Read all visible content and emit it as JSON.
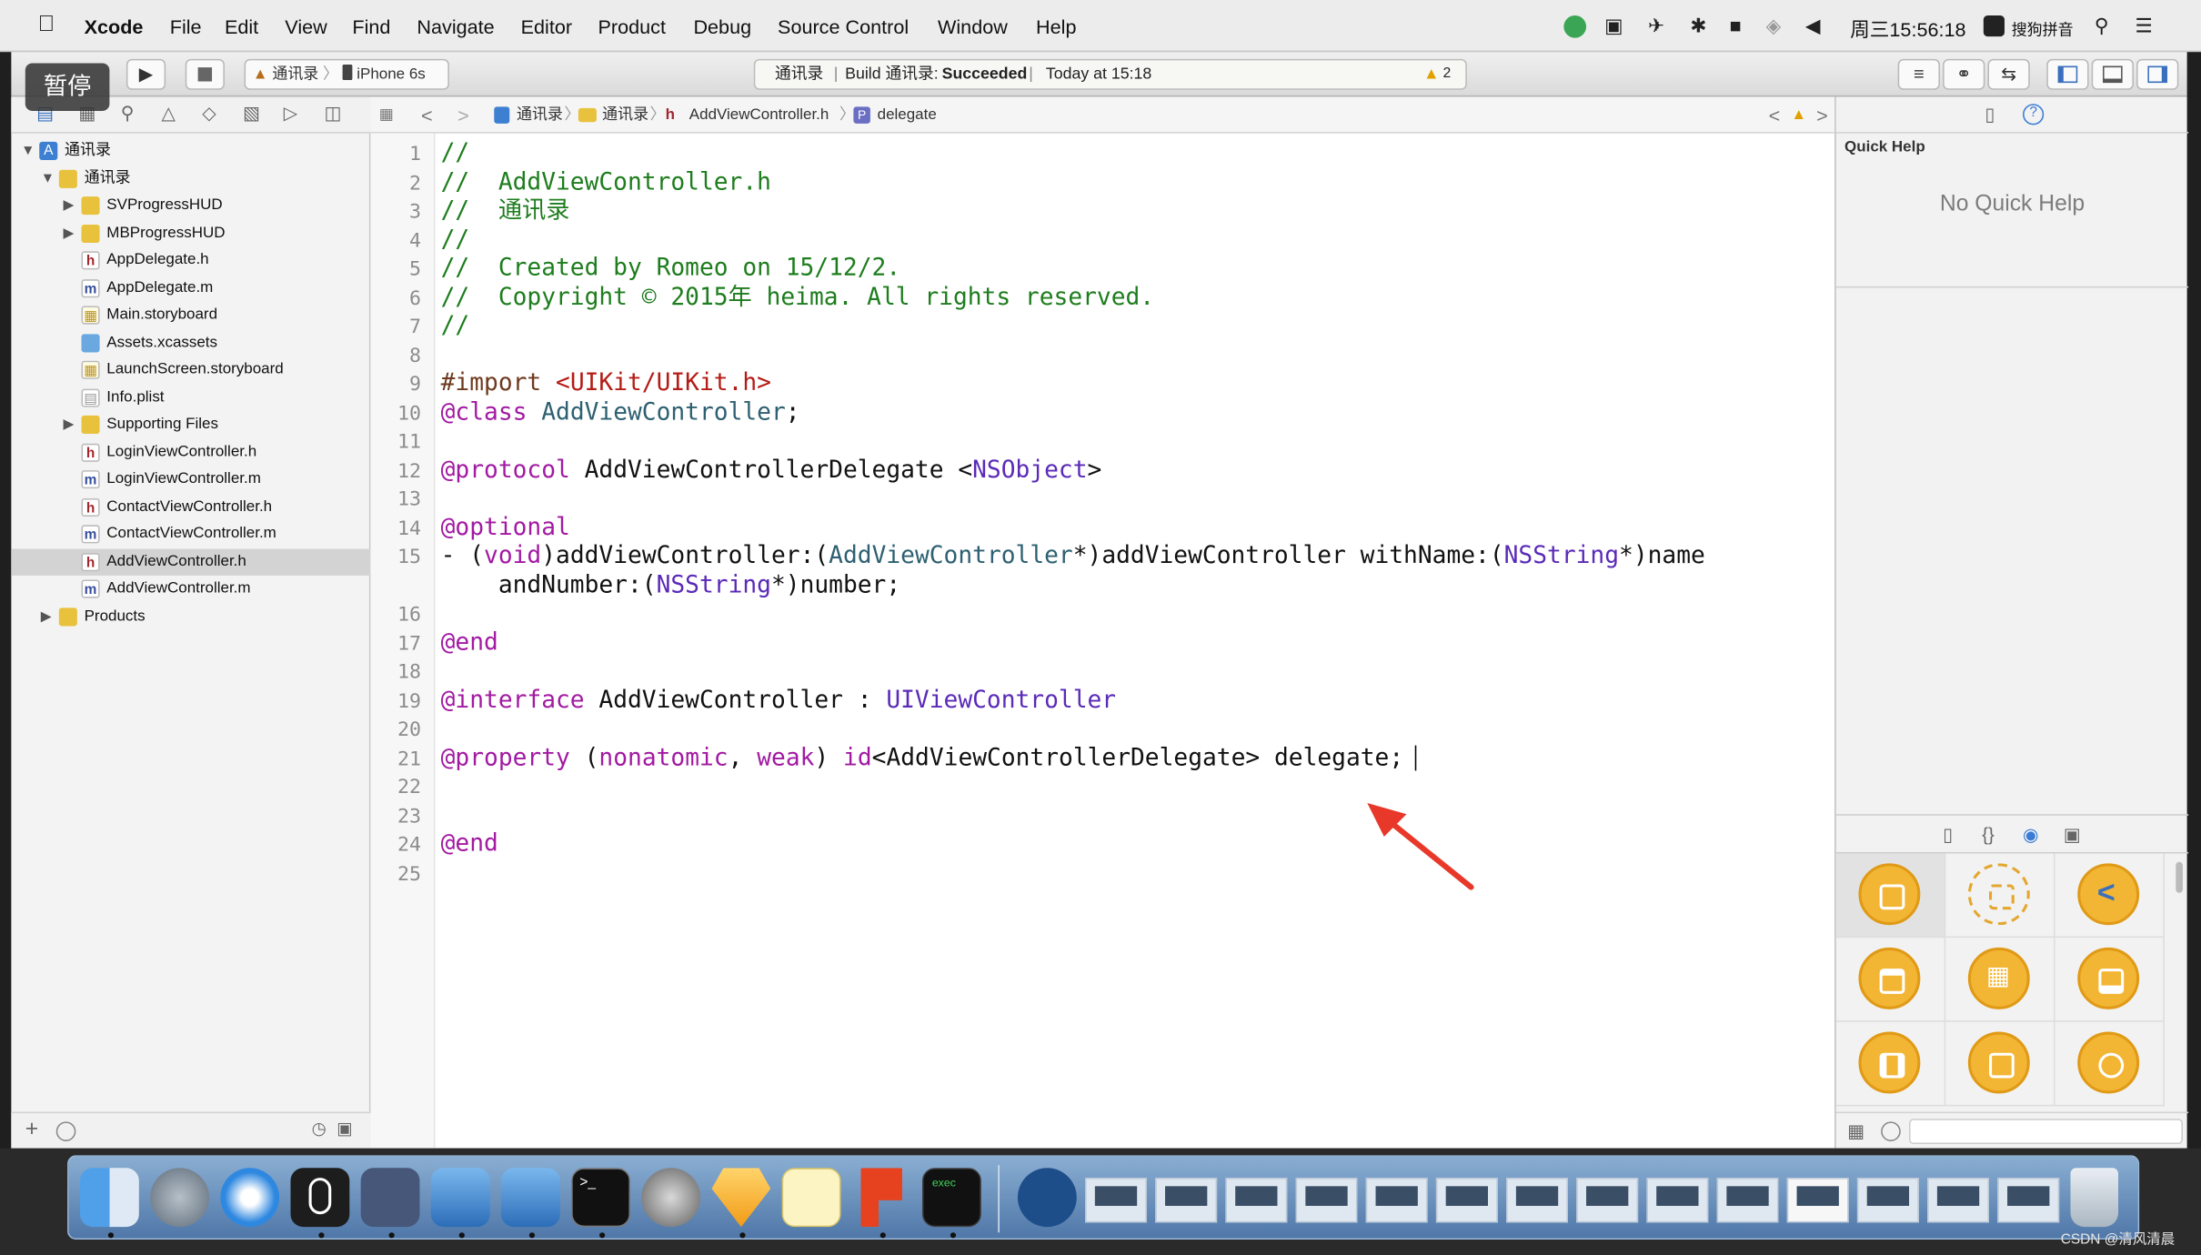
{
  "menubar": {
    "apple_icon": "apple-icon",
    "items": [
      "Xcode",
      "File",
      "Edit",
      "View",
      "Find",
      "Navigate",
      "Editor",
      "Product",
      "Debug",
      "Source Control",
      "Window",
      "Help"
    ],
    "clock": "周三15:56:18",
    "input_method": "搜狗拼音"
  },
  "toolbar": {
    "scheme": "通讯录",
    "device": "iPhone 6s",
    "activity_project": "通讯录",
    "activity_prefix": "Build 通讯录:",
    "activity_status": "Succeeded",
    "activity_time": "Today at 15:18",
    "warning_count": "2"
  },
  "overlay": {
    "paused_label": "暂停"
  },
  "navigator": {
    "items": [
      {
        "label": "通讯录",
        "icon": "project-icon",
        "depth": 0,
        "disclosure": "open"
      },
      {
        "label": "通讯录",
        "icon": "folder-icon",
        "depth": 1,
        "disclosure": "open"
      },
      {
        "label": "SVProgressHUD",
        "icon": "folder-icon",
        "depth": 2,
        "disclosure": "closed"
      },
      {
        "label": "MBProgressHUD",
        "icon": "folder-icon",
        "depth": 2,
        "disclosure": "closed"
      },
      {
        "label": "AppDelegate.h",
        "icon": "header-file-icon",
        "depth": 2
      },
      {
        "label": "AppDelegate.m",
        "icon": "implementation-file-icon",
        "depth": 2
      },
      {
        "label": "Main.storyboard",
        "icon": "storyboard-file-icon",
        "depth": 2
      },
      {
        "label": "Assets.xcassets",
        "icon": "asset-catalog-icon",
        "depth": 2
      },
      {
        "label": "LaunchScreen.storyboard",
        "icon": "storyboard-file-icon",
        "depth": 2
      },
      {
        "label": "Info.plist",
        "icon": "plist-file-icon",
        "depth": 2
      },
      {
        "label": "Supporting Files",
        "icon": "folder-icon",
        "depth": 2,
        "disclosure": "closed"
      },
      {
        "label": "LoginViewController.h",
        "icon": "header-file-icon",
        "depth": 2
      },
      {
        "label": "LoginViewController.m",
        "icon": "implementation-file-icon",
        "depth": 2
      },
      {
        "label": "ContactViewController.h",
        "icon": "header-file-icon",
        "depth": 2
      },
      {
        "label": "ContactViewController.m",
        "icon": "implementation-file-icon",
        "depth": 2
      },
      {
        "label": "AddViewController.h",
        "icon": "header-file-icon",
        "depth": 2,
        "selected": true
      },
      {
        "label": "AddViewController.m",
        "icon": "implementation-file-icon",
        "depth": 2
      },
      {
        "label": "Products",
        "icon": "folder-icon",
        "depth": 1,
        "disclosure": "closed"
      }
    ]
  },
  "jumpbar": {
    "crumbs": [
      "通讯录",
      "通讯录",
      "AddViewController.h",
      "delegate"
    ]
  },
  "editor": {
    "lines": [
      {
        "n": "1",
        "t": [
          [
            "c-com",
            "//"
          ]
        ]
      },
      {
        "n": "2",
        "t": [
          [
            "c-com",
            "//  AddViewController.h"
          ]
        ]
      },
      {
        "n": "3",
        "t": [
          [
            "c-com",
            "//  通讯录"
          ]
        ]
      },
      {
        "n": "4",
        "t": [
          [
            "c-com",
            "//"
          ]
        ]
      },
      {
        "n": "5",
        "t": [
          [
            "c-com",
            "//  Created by Romeo on 15/12/2."
          ]
        ]
      },
      {
        "n": "6",
        "t": [
          [
            "c-com",
            "//  Copyright © 2015年 heima. All rights reserved."
          ]
        ]
      },
      {
        "n": "7",
        "t": [
          [
            "c-com",
            "//"
          ]
        ]
      },
      {
        "n": "8",
        "t": []
      },
      {
        "n": "9",
        "t": [
          [
            "c-pre",
            "#import "
          ],
          [
            "c-str",
            "<UIKit/UIKit.h>"
          ]
        ]
      },
      {
        "n": "10",
        "t": [
          [
            "c-kw",
            "@class "
          ],
          [
            "c-cls",
            "AddViewController"
          ],
          [
            "",
            "; "
          ]
        ]
      },
      {
        "n": "11",
        "t": []
      },
      {
        "n": "12",
        "t": [
          [
            "c-kw",
            "@protocol "
          ],
          [
            "",
            "AddViewControllerDelegate <"
          ],
          [
            "c-typ",
            "NSObject"
          ],
          [
            "",
            ">"
          ]
        ]
      },
      {
        "n": "13",
        "t": []
      },
      {
        "n": "14",
        "t": [
          [
            "c-kw",
            "@optional"
          ]
        ]
      },
      {
        "n": "15",
        "t": [
          [
            "",
            "- ("
          ],
          [
            "c-kw",
            "void"
          ],
          [
            "",
            ")addViewController:("
          ],
          [
            "c-cls",
            "AddViewController"
          ],
          [
            "",
            "*)addViewController withName:("
          ],
          [
            "c-typ",
            "NSString"
          ],
          [
            "",
            "*)name"
          ]
        ]
      },
      {
        "n": "",
        "t": [
          [
            "",
            "    andNumber:("
          ],
          [
            "c-typ",
            "NSString"
          ],
          [
            "",
            "*)number;"
          ]
        ]
      },
      {
        "n": "16",
        "t": []
      },
      {
        "n": "17",
        "t": [
          [
            "c-kw",
            "@end"
          ]
        ]
      },
      {
        "n": "18",
        "t": []
      },
      {
        "n": "19",
        "t": [
          [
            "c-kw",
            "@interface "
          ],
          [
            "",
            "AddViewController : "
          ],
          [
            "c-typ",
            "UIViewController"
          ]
        ]
      },
      {
        "n": "20",
        "t": []
      },
      {
        "n": "21",
        "t": [
          [
            "c-kw",
            "@property "
          ],
          [
            "",
            "("
          ],
          [
            "c-kw",
            "nonatomic"
          ],
          [
            "",
            ", "
          ],
          [
            "c-kw",
            "weak"
          ],
          [
            "",
            ") "
          ],
          [
            "c-kw",
            "id"
          ],
          [
            "",
            "<AddViewControllerDelegate> delegate;"
          ]
        ]
      },
      {
        "n": "22",
        "t": []
      },
      {
        "n": "23",
        "t": []
      },
      {
        "n": "24",
        "t": [
          [
            "c-kw",
            "@end"
          ]
        ]
      },
      {
        "n": "25",
        "t": []
      }
    ]
  },
  "inspector": {
    "title": "Quick Help",
    "empty_text": "No Quick Help"
  },
  "watermark": "CSDN @清风清晨",
  "colors": {
    "annotation_arrow": "#e8382a",
    "library_orange": "#f3b534",
    "selection": "#d3d3d3"
  }
}
